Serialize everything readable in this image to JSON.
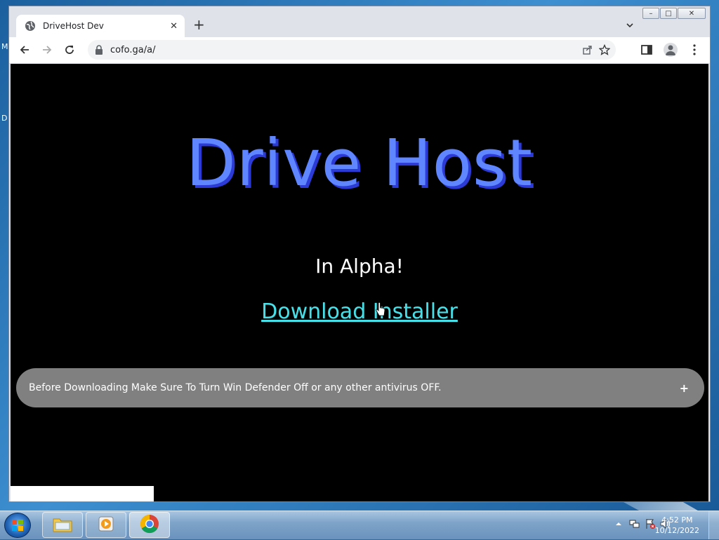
{
  "desktop": {
    "letters": [
      "M",
      "D"
    ]
  },
  "browser": {
    "tab_title": "DriveHost Dev",
    "url": "cofo.ga/a/"
  },
  "page": {
    "hero_title": "Drive Host",
    "subtitle": "In Alpha!",
    "download_link": "Download Installer",
    "notice": "Before Downloading Make Sure To Turn Win Defender Off or any other antivirus OFF.",
    "notice_toggle": "+"
  },
  "taskbar": {
    "time": "4:52 PM",
    "date": "10/12/2022"
  },
  "colors": {
    "hero": "#5f86ff",
    "hero_shadow": "#2c3ad6",
    "link": "#48e0e8",
    "notice_bg": "#808080"
  }
}
